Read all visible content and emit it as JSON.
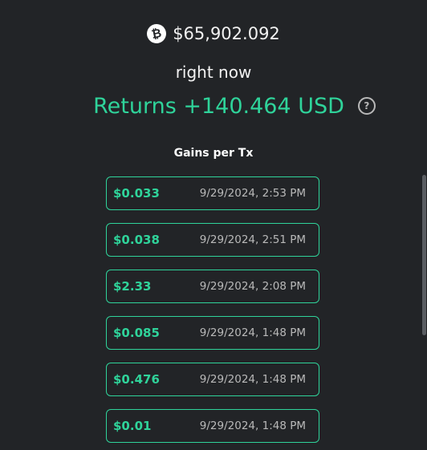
{
  "header": {
    "currency_icon": "bitcoin-icon",
    "price": "$65,902.092",
    "period_label": "right now",
    "returns_label": "Returns +140.464 USD",
    "help_icon": "question-circle-icon"
  },
  "gains": {
    "title": "Gains per Tx",
    "transactions": [
      {
        "amount": "$0.033",
        "time": "9/29/2024, 2:53 PM"
      },
      {
        "amount": "$0.038",
        "time": "9/29/2024, 2:51 PM"
      },
      {
        "amount": "$2.33",
        "time": "9/29/2024, 2:08 PM"
      },
      {
        "amount": "$0.085",
        "time": "9/29/2024, 1:48 PM"
      },
      {
        "amount": "$0.476",
        "time": "9/29/2024, 1:48 PM"
      },
      {
        "amount": "$0.01",
        "time": "9/29/2024, 1:48 PM"
      }
    ]
  },
  "colors": {
    "background": "#222427",
    "accent": "#2fd39a",
    "muted_text": "#b9b9b9"
  }
}
